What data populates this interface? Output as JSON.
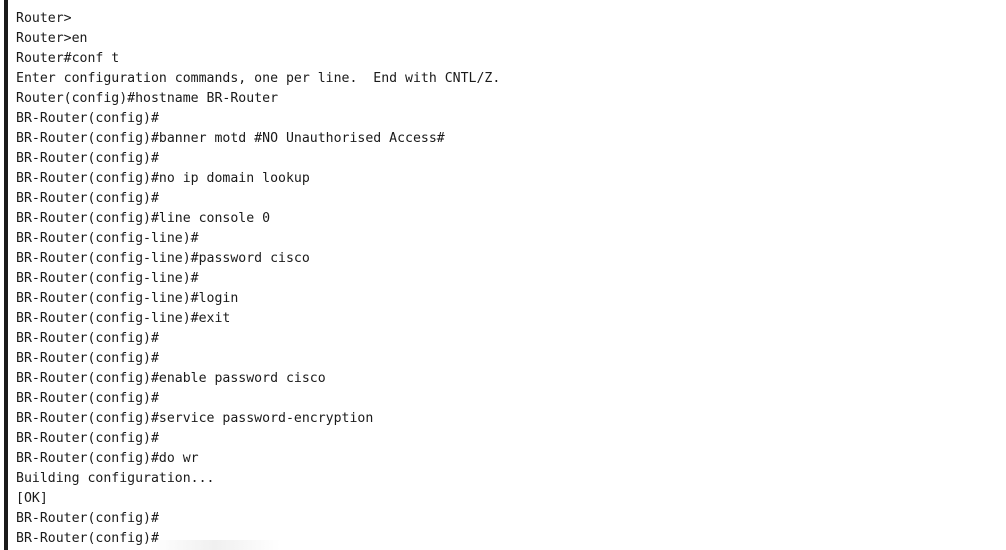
{
  "terminal": {
    "lines": [
      "Router>",
      "Router>en",
      "Router#conf t",
      "Enter configuration commands, one per line.  End with CNTL/Z.",
      "Router(config)#hostname BR-Router",
      "BR-Router(config)#",
      "BR-Router(config)#banner motd #NO Unauthorised Access#",
      "BR-Router(config)#",
      "BR-Router(config)#no ip domain lookup",
      "BR-Router(config)#",
      "BR-Router(config)#line console 0",
      "BR-Router(config-line)#",
      "BR-Router(config-line)#password cisco",
      "BR-Router(config-line)#",
      "BR-Router(config-line)#login",
      "BR-Router(config-line)#exit",
      "BR-Router(config)#",
      "BR-Router(config)#",
      "BR-Router(config)#enable password cisco",
      "BR-Router(config)#",
      "BR-Router(config)#service password-encryption",
      "BR-Router(config)#",
      "BR-Router(config)#do wr",
      "Building configuration...",
      "[OK]",
      "BR-Router(config)#",
      "BR-Router(config)#"
    ]
  }
}
